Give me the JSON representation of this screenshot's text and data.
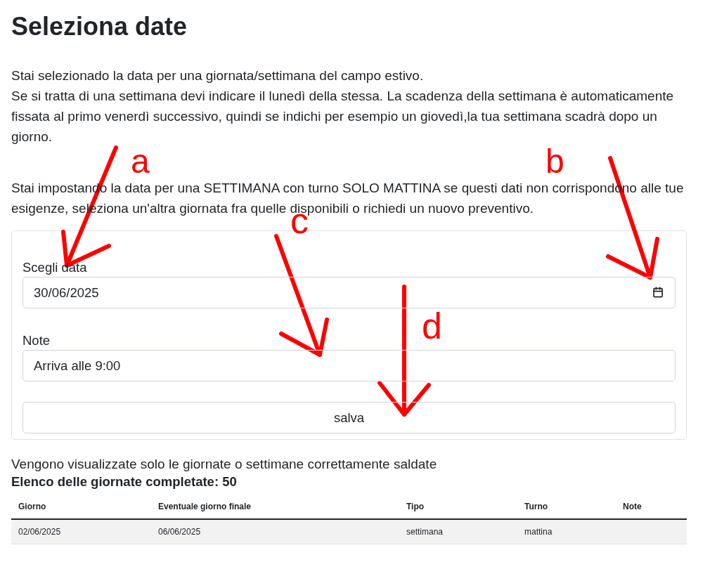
{
  "title": "Seleziona date",
  "intro": [
    "Stai selezionado la data per una giornata/settimana del campo estivo.",
    "Se si tratta di una settimana devi indicare il lunedì della stessa. La scadenza della settimana è automaticamente fissata al primo venerdì successivo, quindi se indichi per esempio un giovedì,la tua settimana scadrà dopo un giorno."
  ],
  "notice": "Stai impostando la data per una SETTIMANA con turno SOLO MATTINA se questi dati non corrispondono alle tue esigenze, seleziona un'altra giornata fra quelle disponibili o richiedi un nuovo preventivo.",
  "form": {
    "date_label": "Scegli data",
    "date_value": "30/06/2025",
    "note_label": "Note",
    "note_value": "Arriva alle 9:00",
    "button": "salva"
  },
  "info": "Vengono visualizzate solo le giornate o settimane correttamente saldate",
  "list_title": "Elenco delle giornate completate: 50",
  "table": {
    "columns": [
      "Giorno",
      "Eventuale giorno finale",
      "Tipo",
      "Turno",
      "Note"
    ],
    "rows": [
      [
        "02/06/2025",
        "06/06/2025",
        "settimana",
        "mattina",
        ""
      ]
    ]
  },
  "annotations": [
    "a",
    "b",
    "c",
    "d"
  ]
}
